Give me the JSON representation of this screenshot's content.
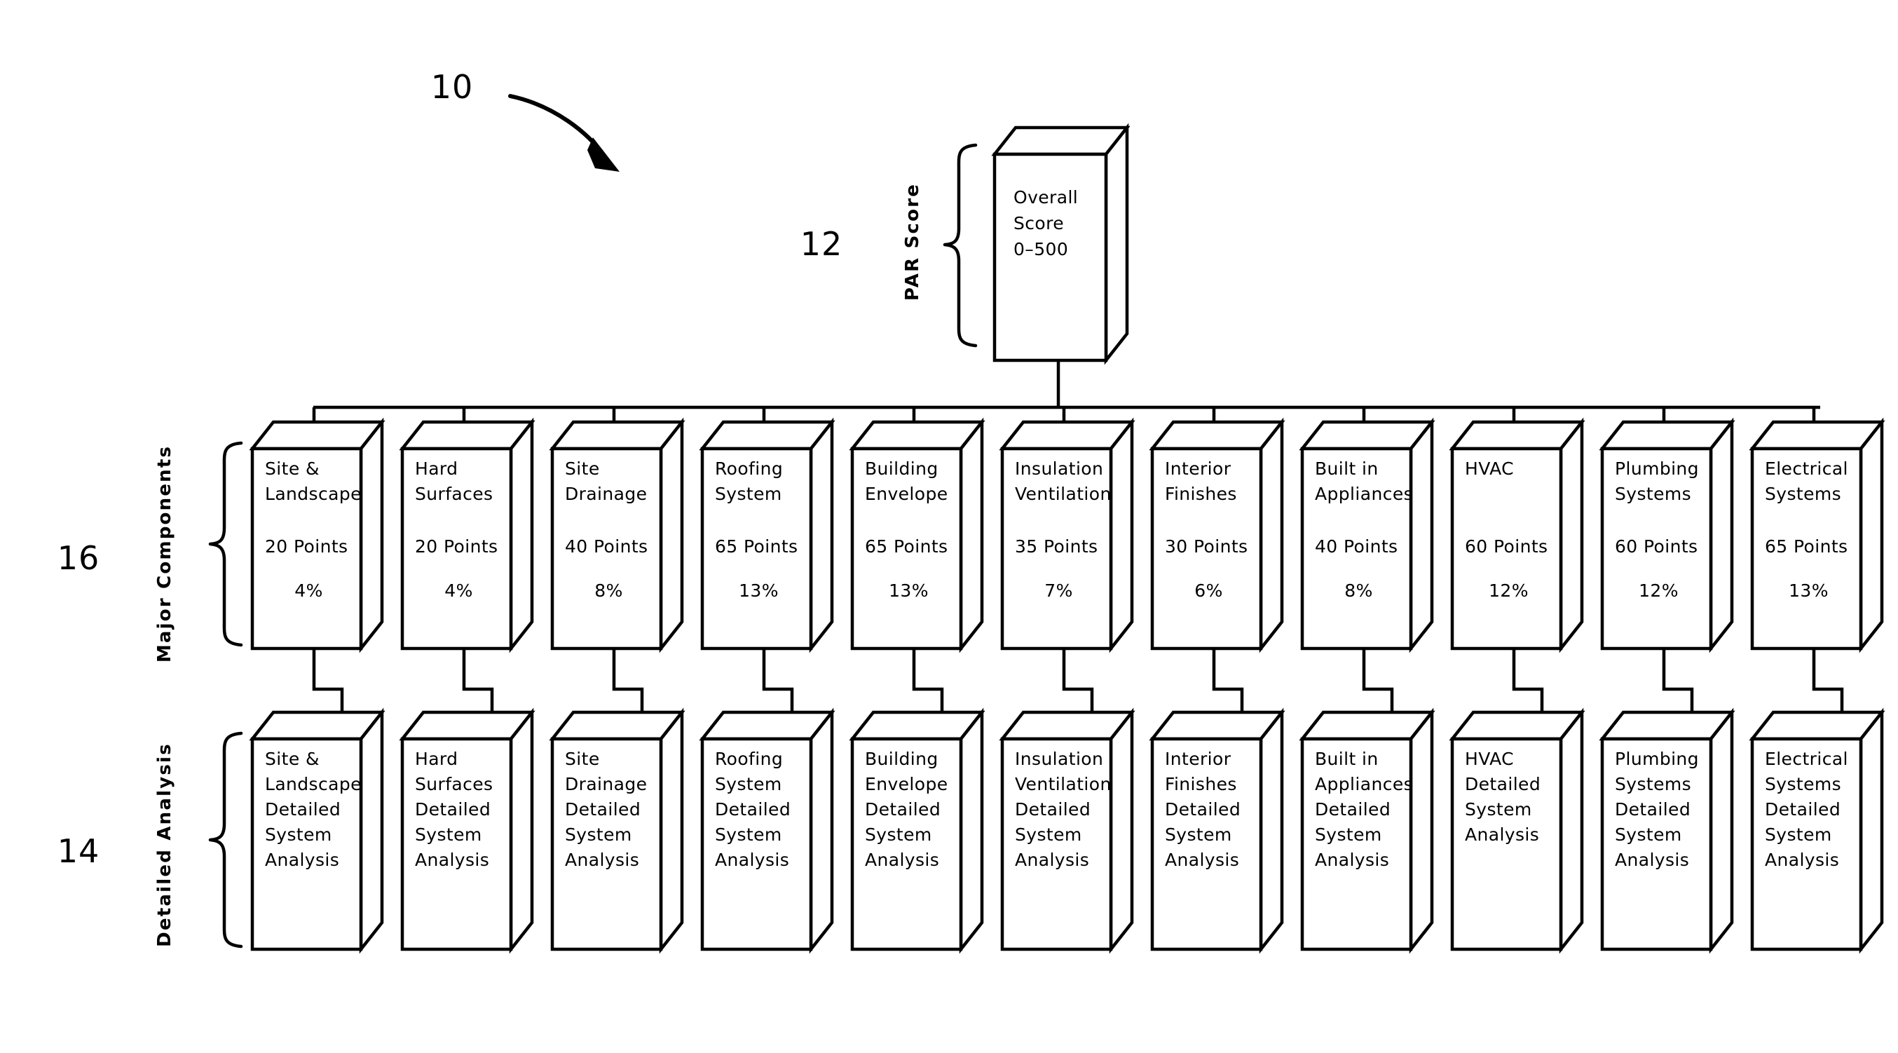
{
  "figure": {
    "reference_numerals": {
      "overall": "10",
      "par_score": "12",
      "major_components": "16",
      "detailed_analysis": "14"
    },
    "group_labels": {
      "par_score": "PAR Score",
      "major_components": "Major Components",
      "detailed_analysis": "Detailed Analysis"
    }
  },
  "root": {
    "line1": "Overall",
    "line2": "Score",
    "line3": "0–500"
  },
  "components": [
    {
      "name_line1": "Site  &",
      "name_line2": "Landscape",
      "points": "20  Points",
      "percent": "4%",
      "detail_lines": [
        "Site  &",
        "Landscape",
        "Detailed",
        "System",
        "Analysis"
      ]
    },
    {
      "name_line1": "Hard",
      "name_line2": "Surfaces",
      "points": "20  Points",
      "percent": "4%",
      "detail_lines": [
        "Hard",
        "Surfaces",
        "Detailed",
        "System",
        "Analysis"
      ]
    },
    {
      "name_line1": "Site",
      "name_line2": "Drainage",
      "points": "40  Points",
      "percent": "8%",
      "detail_lines": [
        "Site",
        "Drainage",
        "Detailed",
        "System",
        "Analysis"
      ]
    },
    {
      "name_line1": "Roofing",
      "name_line2": "System",
      "points": "65  Points",
      "percent": "13%",
      "detail_lines": [
        "Roofing",
        "System",
        "Detailed",
        "System",
        "Analysis"
      ]
    },
    {
      "name_line1": "Building",
      "name_line2": "Envelope",
      "points": "65  Points",
      "percent": "13%",
      "detail_lines": [
        "Building",
        "Envelope",
        "Detailed",
        "System",
        "Analysis"
      ]
    },
    {
      "name_line1": "Insulation",
      "name_line2": "Ventilation",
      "points": "35  Points",
      "percent": "7%",
      "detail_lines": [
        "Insulation",
        "Ventilation",
        "Detailed",
        "System",
        "Analysis"
      ]
    },
    {
      "name_line1": "Interior",
      "name_line2": "Finishes",
      "points": "30  Points",
      "percent": "6%",
      "detail_lines": [
        "Interior",
        "Finishes",
        "Detailed",
        "System",
        "Analysis"
      ]
    },
    {
      "name_line1": "Built  in",
      "name_line2": "Appliances",
      "points": "40  Points",
      "percent": "8%",
      "detail_lines": [
        "Built  in",
        "Appliances",
        "Detailed",
        "System",
        "Analysis"
      ]
    },
    {
      "name_line1": "HVAC",
      "name_line2": "",
      "points": "60  Points",
      "percent": "12%",
      "detail_lines": [
        "HVAC",
        "Detailed",
        "System",
        "Analysis"
      ]
    },
    {
      "name_line1": "Plumbing",
      "name_line2": "Systems",
      "points": "60  Points",
      "percent": "12%",
      "detail_lines": [
        "Plumbing",
        "Systems",
        "Detailed",
        "System",
        "Analysis"
      ]
    },
    {
      "name_line1": "Electrical",
      "name_line2": "Systems",
      "points": "65  Points",
      "percent": "13%",
      "detail_lines": [
        "Electrical",
        "Systems",
        "Detailed",
        "System",
        "Analysis"
      ]
    }
  ],
  "chart_data": {
    "type": "table",
    "title": "PAR Score component weighting",
    "columns": [
      "Major Component",
      "Points",
      "Percent"
    ],
    "rows": [
      [
        "Site & Landscape",
        20,
        4
      ],
      [
        "Hard Surfaces",
        20,
        4
      ],
      [
        "Site Drainage",
        40,
        8
      ],
      [
        "Roofing System",
        65,
        13
      ],
      [
        "Building Envelope",
        65,
        13
      ],
      [
        "Insulation Ventilation",
        35,
        7
      ],
      [
        "Interior Finishes",
        30,
        6
      ],
      [
        "Built in Appliances",
        40,
        8
      ],
      [
        "HVAC",
        60,
        12
      ],
      [
        "Plumbing Systems",
        60,
        12
      ],
      [
        "Electrical Systems",
        65,
        13
      ]
    ],
    "total_points": 500,
    "score_range": [
      0,
      500
    ]
  }
}
